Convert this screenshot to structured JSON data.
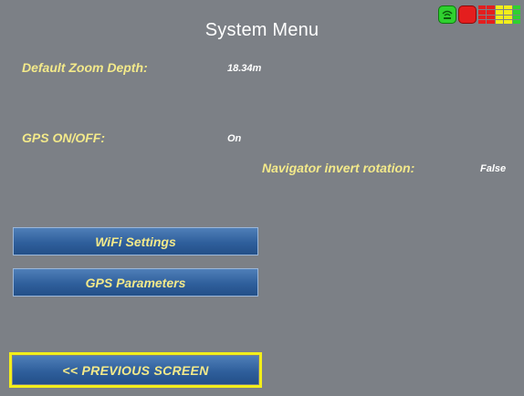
{
  "header": {
    "title": "System Menu"
  },
  "settings": {
    "default_zoom_depth": {
      "label": "Default Zoom Depth:",
      "value": "18.34m"
    },
    "gps_on_off": {
      "label": "GPS ON/OFF:",
      "value": "On"
    },
    "navigator_invert_rotation": {
      "label": "Navigator invert rotation:",
      "value": "False"
    }
  },
  "buttons": {
    "wifi_settings": "WiFi Settings",
    "gps_parameters": "GPS Parameters",
    "previous_screen": "<< PREVIOUS SCREEN"
  },
  "status": {
    "wifi_color": "#2fd12f",
    "record_color": "#e41e1e",
    "level_colors": [
      "#e41e1e",
      "#e41e1e",
      "#f2ee1a",
      "#f2ee1a",
      "#2fd12f"
    ]
  },
  "colors": {
    "background": "#7c8086",
    "label": "#f3e98a",
    "value": "#ffffff",
    "button": "#2f5f9c",
    "focus_outline": "#f2ee1a"
  }
}
